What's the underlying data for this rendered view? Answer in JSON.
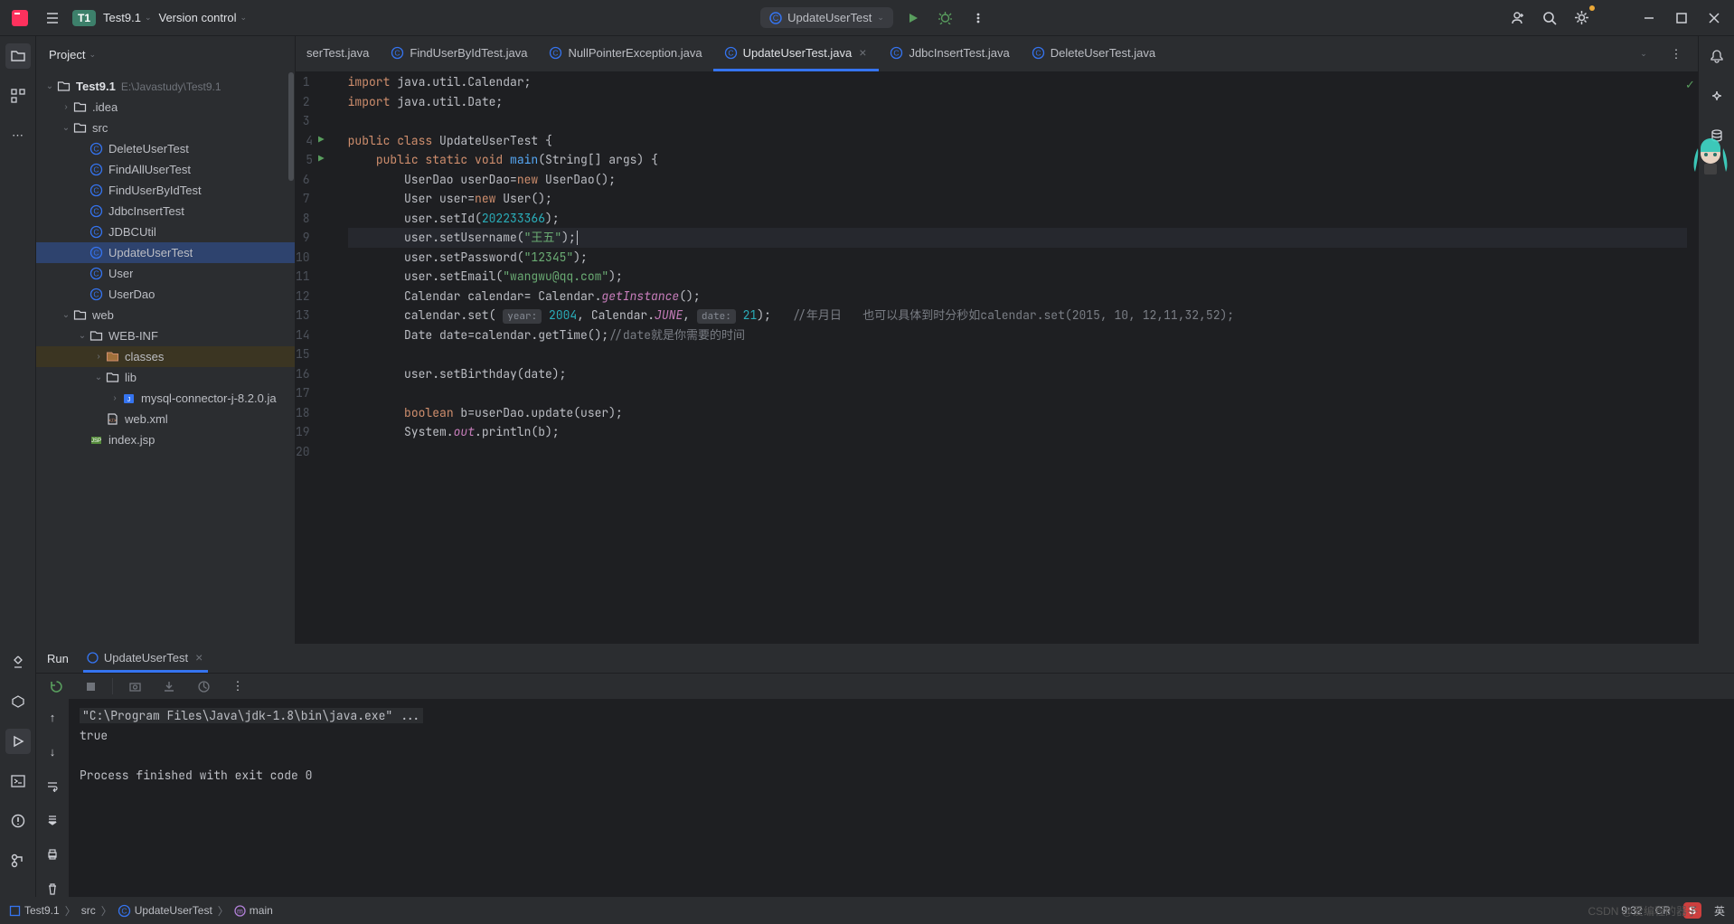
{
  "header": {
    "project_badge": "T1",
    "project_name": "Test9.1",
    "version_control": "Version control",
    "run_config": "UpdateUserTest"
  },
  "sidebar": {
    "title": "Project",
    "root": {
      "name": "Test9.1",
      "path": "E:\\Javastudy\\Test9.1"
    },
    "items": [
      {
        "indent": 1,
        "arrow": ">",
        "type": "folder",
        "label": ".idea"
      },
      {
        "indent": 1,
        "arrow": "v",
        "type": "folder",
        "label": "src"
      },
      {
        "indent": 2,
        "arrow": "",
        "type": "class",
        "label": "DeleteUserTest"
      },
      {
        "indent": 2,
        "arrow": "",
        "type": "class",
        "label": "FindAllUserTest"
      },
      {
        "indent": 2,
        "arrow": "",
        "type": "class",
        "label": "FindUserByIdTest"
      },
      {
        "indent": 2,
        "arrow": "",
        "type": "class",
        "label": "JdbcInsertTest"
      },
      {
        "indent": 2,
        "arrow": "",
        "type": "class",
        "label": "JDBCUtil"
      },
      {
        "indent": 2,
        "arrow": "",
        "type": "class",
        "label": "UpdateUserTest",
        "selected": true
      },
      {
        "indent": 2,
        "arrow": "",
        "type": "class",
        "label": "User"
      },
      {
        "indent": 2,
        "arrow": "",
        "type": "class",
        "label": "UserDao"
      },
      {
        "indent": 1,
        "arrow": "v",
        "type": "folder",
        "label": "web"
      },
      {
        "indent": 2,
        "arrow": "v",
        "type": "folder",
        "label": "WEB-INF"
      },
      {
        "indent": 3,
        "arrow": ">",
        "type": "folder-hl",
        "label": "classes",
        "highlighted": true
      },
      {
        "indent": 3,
        "arrow": "v",
        "type": "folder",
        "label": "lib"
      },
      {
        "indent": 4,
        "arrow": ">",
        "type": "jar",
        "label": "mysql-connector-j-8.2.0.ja"
      },
      {
        "indent": 3,
        "arrow": "",
        "type": "xml",
        "label": "web.xml"
      },
      {
        "indent": 2,
        "arrow": "",
        "type": "jsp",
        "label": "index.jsp"
      }
    ]
  },
  "tabs": [
    {
      "label": "serTest.java",
      "partial": true,
      "icon": "class"
    },
    {
      "label": "FindUserByIdTest.java",
      "icon": "class"
    },
    {
      "label": "NullPointerException.java",
      "icon": "class"
    },
    {
      "label": "UpdateUserTest.java",
      "icon": "class",
      "active": true,
      "closable": true
    },
    {
      "label": "JdbcInsertTest.java",
      "icon": "class"
    },
    {
      "label": "DeleteUserTest.java",
      "icon": "class"
    }
  ],
  "code": {
    "lines": [
      {
        "n": 1,
        "html": "<span class='kw'>import</span> java.util.Calendar;"
      },
      {
        "n": 2,
        "html": "<span class='kw'>import</span> java.util.Date;"
      },
      {
        "n": 3,
        "html": ""
      },
      {
        "n": 4,
        "run": true,
        "html": "<span class='kw'>public class</span> UpdateUserTest {"
      },
      {
        "n": 5,
        "run": true,
        "html": "    <span class='kw'>public static void</span> <span class='method-use'>main</span>(String[] args) {"
      },
      {
        "n": 6,
        "html": "        UserDao userDao=<span class='kw'>new</span> UserDao();"
      },
      {
        "n": 7,
        "html": "        User user=<span class='kw'>new</span> User();"
      },
      {
        "n": 8,
        "html": "        user.setId(<span class='num'>202233366</span>);"
      },
      {
        "n": 9,
        "current": true,
        "html": "        user.setUsername(<span class='str'>\"王五\"</span>);<span class='cursor-caret'></span>"
      },
      {
        "n": 10,
        "html": "        user.setPassword(<span class='str'>\"12345\"</span>);"
      },
      {
        "n": 11,
        "html": "        user.setEmail(<span class='str'>\"wangwu@qq.com\"</span>);"
      },
      {
        "n": 12,
        "html": "        Calendar calendar= Calendar.<span class='static-field'>getInstance</span>();"
      },
      {
        "n": 13,
        "html": "        calendar.set( <span class='param-hint'>year:</span> <span class='num'>2004</span>, Calendar.<span class='static-field'>JUNE</span>, <span class='param-hint'>date:</span> <span class='num'>21</span>);   <span class='comment'>//年月日   也可以具体到时分秒如calendar.set(2015, 10, 12,11,32,52);</span>"
      },
      {
        "n": 14,
        "html": "        Date date=calendar.getTime();<span class='comment'>//date就是你需要的时间</span>"
      },
      {
        "n": 15,
        "html": ""
      },
      {
        "n": 16,
        "html": "        user.setBirthday(date);"
      },
      {
        "n": 17,
        "html": ""
      },
      {
        "n": 18,
        "html": "        <span class='kw'>boolean</span> b=userDao.update(user);"
      },
      {
        "n": 19,
        "html": "        System.<span class='static-field'>out</span>.println(b);"
      },
      {
        "n": 20,
        "html": ""
      }
    ]
  },
  "run_panel": {
    "title": "Run",
    "tab": "UpdateUserTest",
    "cmd": "\"C:\\Program Files\\Java\\jdk-1.8\\bin\\java.exe\" ...",
    "out1": "true",
    "out2": "Process finished with exit code 0"
  },
  "breadcrumbs": [
    {
      "icon": "module",
      "label": "Test9.1"
    },
    {
      "icon": "",
      "label": "src"
    },
    {
      "icon": "class",
      "label": "UpdateUserTest"
    },
    {
      "icon": "method",
      "label": "main"
    }
  ],
  "status": {
    "pos": "9:32",
    "enc": "CR",
    "lang_badge": "S",
    "lang": "英",
    "watermark": "CSDN @爱编程的器子"
  }
}
